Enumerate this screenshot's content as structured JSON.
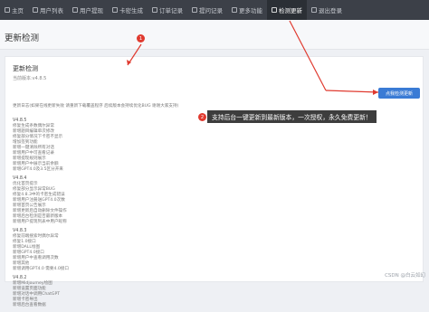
{
  "nav": {
    "items": [
      {
        "label": "主页",
        "active": false
      },
      {
        "label": "用户列表",
        "active": false
      },
      {
        "label": "用户提现",
        "active": false
      },
      {
        "label": "卡密生成",
        "active": false
      },
      {
        "label": "订单记录",
        "active": false
      },
      {
        "label": "提问记录",
        "active": false
      },
      {
        "label": "更多功能",
        "active": false
      },
      {
        "label": "检测更新",
        "active": true
      },
      {
        "label": "退出登录",
        "active": false
      }
    ]
  },
  "page": {
    "title": "更新检测"
  },
  "card": {
    "title": "更新检测",
    "current_version": "当前版本:v4.8.5",
    "update_button": "点我检测更新",
    "note": "更新日志(如果在线更新失败 请重新下载覆盖程序 后续版本会持续优化BUG 谢谢大家支持)"
  },
  "changelog": [
    {
      "version": "V4.8.5",
      "lines": [
        "修复生成条数偶尔异常",
        "新增题目编辑单次修改",
        "修复部分情况下卡密不显示",
        "增加签到功能",
        "新增一键清除所有对话",
        "新增用户中可查看记录",
        "新增提现规则展示",
        "新增用户中展示当前余额",
        "新增GPT4.0及3.5区分开来"
      ]
    },
    {
      "version": "V4.8.4",
      "lines": [
        "优化首页提示",
        "修复部分显示异常BUG",
        "修复4.8.3中的卡密生成错误",
        "新增用户注册送GPT4.0次数",
        "新增首页公告展示",
        "新增更新后自动删除文件操作",
        "新增后台检测是否最新版本",
        "新增用户提现列表中用户昵称"
      ]
    },
    {
      "version": "V4.8.3",
      "lines": [
        "修复前端搜索时偶尔异常",
        "修复1.0接口",
        "新增DALL绘图",
        "新增GPT4.0接口",
        "新增用户中查看调用次数",
        "新增其他",
        "新增调用GPT4.0 需要4.0接口"
      ]
    },
    {
      "version": "V4.8.2",
      "lines": [
        "新增Midjourney绘图",
        "新增设置页面功能",
        "新增对话中调用ChatGPT",
        "新增卡密导出",
        "新增后台查看数据"
      ]
    }
  ],
  "annotations": {
    "badge1": "1",
    "badge2": "2",
    "callout": "支持后台一键更新到最新版本，一次授权，永久免费更新！"
  },
  "watermark": "CSDN @白云如幻",
  "colors": {
    "nav_bg": "#3c4048",
    "accent": "#3a7bd5",
    "annotation": "#e03a2f"
  }
}
